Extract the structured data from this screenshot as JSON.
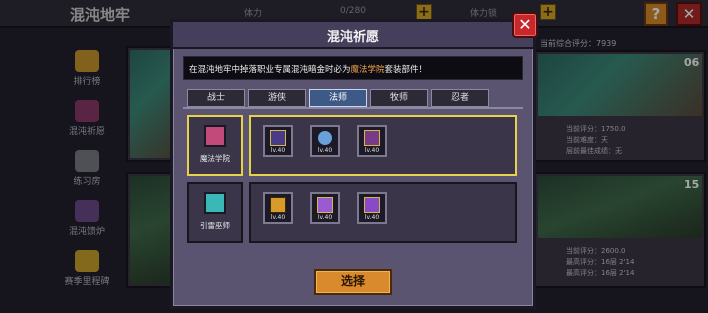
{
  "background": {
    "title": "混沌地牢",
    "stamina_label": "体力",
    "stamina_value": "0/280",
    "stamina_label2": "体力锁",
    "help_label": "?",
    "close_label": "✕",
    "sidebar": [
      {
        "label": "排行榜",
        "icon": "trophy-icon"
      },
      {
        "label": "混沌祈愿",
        "icon": "wish-icon"
      },
      {
        "label": "练习房",
        "icon": "practice-icon"
      },
      {
        "label": "混沌馈炉",
        "icon": "forge-icon"
      },
      {
        "label": "赛季里程碑",
        "icon": "star-icon"
      }
    ],
    "right_top_score": "当前综合评分：7939",
    "right_panel_1": {
      "number": "06",
      "lines": [
        "当前评分：1750.0",
        "当前难度：天",
        "层前最佳成绩：无"
      ]
    },
    "right_panel_2": {
      "number": "15",
      "lines": [
        "当前评分：2600.0",
        "最高评分：16层 2'14",
        "最高评分：16层 2'14"
      ]
    }
  },
  "modal": {
    "title": "混沌祈愿",
    "close_label": "✕",
    "info_prefix": "在混沌地牢中掉落职业专属混沌暗金时必为",
    "info_highlight": "魔法学院",
    "info_suffix": "套装部件！",
    "tabs": [
      {
        "label": "战士",
        "active": false
      },
      {
        "label": "游侠",
        "active": false
      },
      {
        "label": "法师",
        "active": true
      },
      {
        "label": "牧师",
        "active": false
      },
      {
        "label": "忍者",
        "active": false
      }
    ],
    "rows": [
      {
        "class_label": "魔法学院",
        "class_icon": "magic-academy-icon",
        "selected": true,
        "items": [
          {
            "name": "academy-hat-icon",
            "lv": "lv.40"
          },
          {
            "name": "academy-orb-icon",
            "lv": "lv.40"
          },
          {
            "name": "academy-robe-icon",
            "lv": "lv.40"
          }
        ]
      },
      {
        "class_label": "引雷巫师",
        "class_icon": "thunder-wizard-icon",
        "selected": false,
        "items": [
          {
            "name": "thunder-hat-icon",
            "lv": "lv.40"
          },
          {
            "name": "thunder-armor-icon",
            "lv": "lv.40"
          },
          {
            "name": "thunder-boots-icon",
            "lv": "lv.40"
          }
        ]
      }
    ],
    "select_label": "选择"
  }
}
